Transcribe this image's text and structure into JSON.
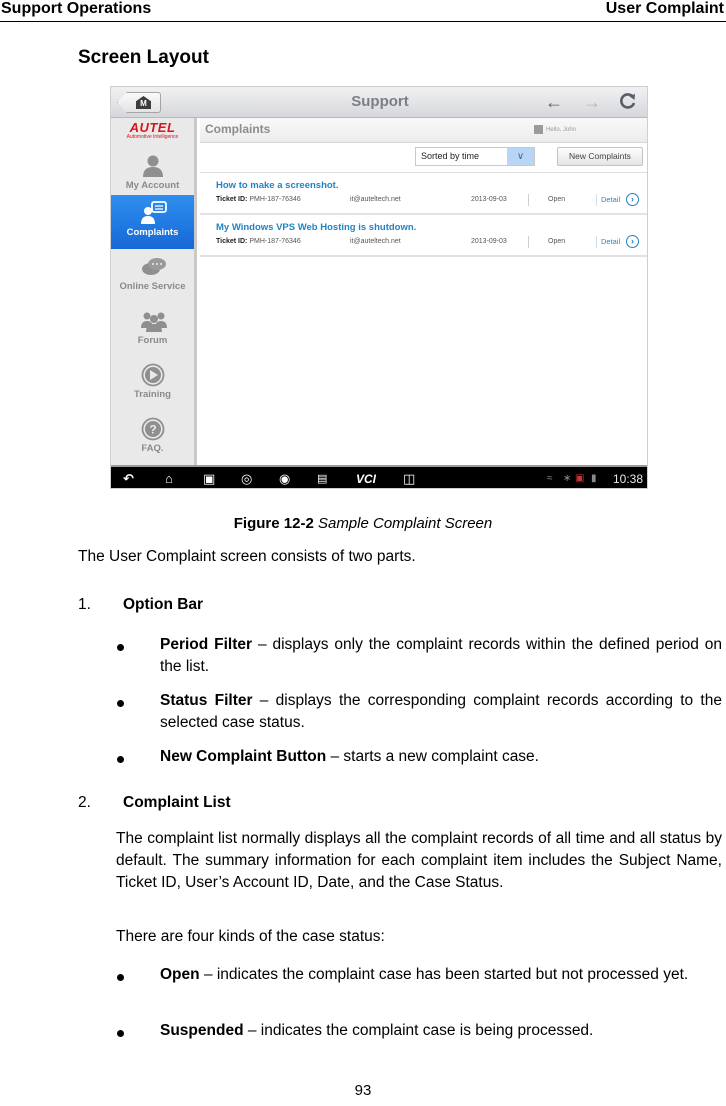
{
  "header": {
    "left": "Support Operations",
    "right": "User Complaint"
  },
  "section_title": "Screen Layout",
  "screenshot": {
    "topbar": {
      "home_label": "M",
      "title": "Support",
      "back_icon": "←",
      "forward_icon": "→",
      "refresh_icon": "C"
    },
    "logo": {
      "brand": "AUTEL",
      "tagline": "Automotive Intelligence"
    },
    "sidebar": [
      {
        "label": "My Account",
        "icon": "person-icon",
        "active": false
      },
      {
        "label": "Complaints",
        "icon": "complaint-chat-icon",
        "active": true
      },
      {
        "label": "Online Service",
        "icon": "chat-bubbles-icon",
        "active": false
      },
      {
        "label": "Forum",
        "icon": "group-icon",
        "active": false
      },
      {
        "label": "Training",
        "icon": "play-icon",
        "active": false
      },
      {
        "label": "FAQ.",
        "icon": "question-icon",
        "active": false
      }
    ],
    "content": {
      "title": "Complaints",
      "greeting": "Hello, John",
      "sort_select": {
        "value": "Sorted by time"
      },
      "new_button": "New Complaints",
      "rows": [
        {
          "subject": "How to make a screenshot.",
          "ticket_label": "Ticket ID:",
          "ticket_id": "PMH-187-76346",
          "account": "it@auteltech.net",
          "date": "2013-09-03",
          "status": "Open",
          "detail": "Detail"
        },
        {
          "subject": "My Windows VPS Web Hosting is shutdown.",
          "ticket_label": "Ticket ID:",
          "ticket_id": "PMH-187-76346",
          "account": "it@auteltech.net",
          "date": "2013-09-03",
          "status": "Open",
          "detail": "Detail"
        }
      ]
    },
    "system_bar": {
      "icons": [
        "back-icon",
        "home-icon",
        "recent-apps-icon",
        "browser-icon",
        "camera-icon",
        "display-icon",
        "vci-icon",
        "car-icon"
      ],
      "vci_label": "VCI",
      "time": "10:38"
    }
  },
  "caption": {
    "label": "Figure 12-2",
    "text": "Sample Complaint Screen"
  },
  "intro": "The User Complaint screen consists of two parts.",
  "sections": [
    {
      "number": "1.",
      "title": "Option Bar",
      "bullets": [
        {
          "term": "Period Filter",
          "text": "– displays only the complaint records within the defined period on the list."
        },
        {
          "term": "Status Filter",
          "text": "– displays the corresponding complaint records according to the selected case status."
        },
        {
          "term": "New Complaint Button",
          "text": "– starts a new complaint case."
        }
      ]
    },
    {
      "number": "2.",
      "title": "Complaint List",
      "paragraph": "The complaint list normally displays all the complaint records of all time and all status by default. The summary information for each complaint item includes the Subject Name, Ticket ID, User’s Account ID, Date, and the Case Status.",
      "status_intro": "There are four kinds of the case status:",
      "bullets": [
        {
          "term": "Open",
          "text": "– indicates the complaint case has been started but not processed yet."
        },
        {
          "term": "Suspended",
          "text": "– indicates the complaint case is being processed."
        }
      ]
    }
  ],
  "page_number": "93"
}
